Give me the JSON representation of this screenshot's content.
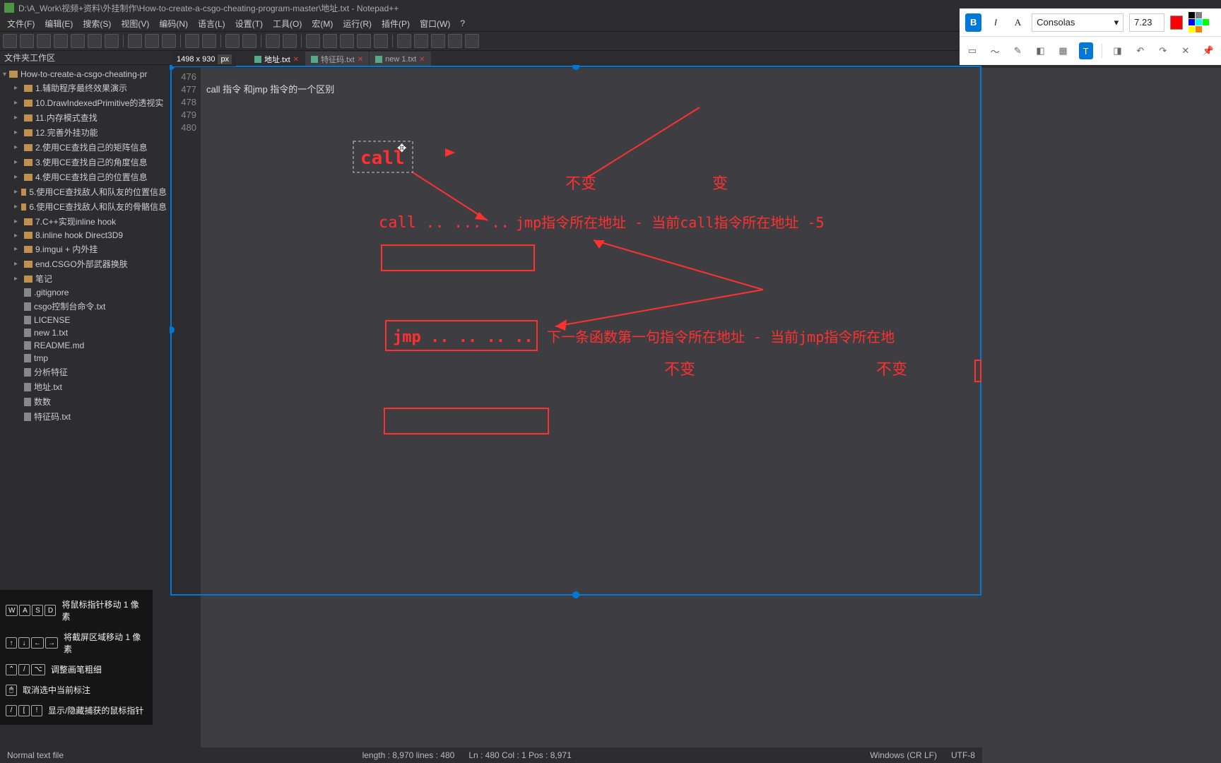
{
  "window": {
    "title": "D:\\A_Work\\视频+资料\\外挂制作\\How-to-create-a-csgo-cheating-program-master\\地址.txt - Notepad++"
  },
  "menus": [
    "文件(F)",
    "编辑(E)",
    "搜索(S)",
    "视图(V)",
    "编码(N)",
    "语言(L)",
    "设置(T)",
    "工具(O)",
    "宏(M)",
    "运行(R)",
    "插件(P)",
    "窗口(W)",
    "?"
  ],
  "workspace_label": "文件夹工作区",
  "project_root": "How-to-create-a-csgo-cheating-pr",
  "tree_dirs": [
    "1.辅助程序最终效果演示",
    "10.DrawIndexedPrimitive的透视实",
    "11.内存模式查找",
    "12.完善外挂功能",
    "2.使用CE查找自己的矩阵信息",
    "3.使用CE查找自己的角度信息",
    "4.使用CE查找自己的位置信息",
    "5.使用CE查找敌人和队友的位置信息",
    "6.使用CE查找敌人和队友的骨骼信息",
    "7.C++实现inline hook",
    "8.inline hook Direct3D9",
    "9.imgui + 内外挂",
    "end.CSGO外部武器换肤",
    "笔记"
  ],
  "tree_files": [
    ".gitignore",
    "csgo控制台命令.txt",
    "LICENSE",
    "new 1.txt",
    "README.md",
    "tmp",
    "分析特征",
    "地址.txt",
    "数数",
    "特征码.txt"
  ],
  "size_indicator": {
    "dims": "1498 x 930",
    "unit": "px"
  },
  "tabs": [
    {
      "label": "地址.txt",
      "active": true
    },
    {
      "label": "特征码.txt",
      "active": false
    },
    {
      "label": "new 1.txt",
      "active": false
    }
  ],
  "gutter_lines": [
    "476",
    "477",
    "478",
    "479",
    "480"
  ],
  "code_lines": [
    "",
    "call 指令 和jmp 指令的一个区别",
    "",
    "",
    ""
  ],
  "annotations": {
    "call_box_text": "call",
    "label_unchanged1": "不变",
    "label_changed": "变",
    "expr_call": "call .. ... ..",
    "expr_jmp_desc": "jmp指令所在地址 - 当前call指令所在地址 -5",
    "jmp_box_text": "jmp .. .. .. ..",
    "next_desc": "下一条函数第一句指令所在地址 - 当前jmp指令所在地",
    "label_unchanged2": "不变",
    "label_unchanged3": "不变"
  },
  "hints": [
    {
      "k": [
        "W",
        "A",
        "S",
        "D"
      ],
      "t": "将鼠标指针移动 1 像素"
    },
    {
      "k": [
        "↑",
        "↓",
        "←",
        "→"
      ],
      "t": "将截屏区域移动 1 像素"
    },
    {
      "k": [
        "⌃",
        "/",
        "⌥"
      ],
      "t": "调整画笔粗细"
    },
    {
      "k": [
        "🖱"
      ],
      "t": "取消选中当前标注"
    },
    {
      "k": [
        "/",
        "[",
        "!"
      ],
      "t": "显示/隐藏捕获的鼠标指针"
    }
  ],
  "anno_toolbar": {
    "font": "Consolas",
    "size": "7.23",
    "colors": [
      "#000000",
      "#808080",
      "#ffffff",
      "#0000ff",
      "#00ffff",
      "#00ff00",
      "#ffff00",
      "#ff8000"
    ]
  },
  "statusbar": {
    "left": "Normal text file",
    "center": "length : 8,970    lines : 480",
    "position": "Ln : 480    Col : 1    Pos : 8,971",
    "eol": "Windows (CR LF)",
    "encoding": "UTF-8"
  }
}
